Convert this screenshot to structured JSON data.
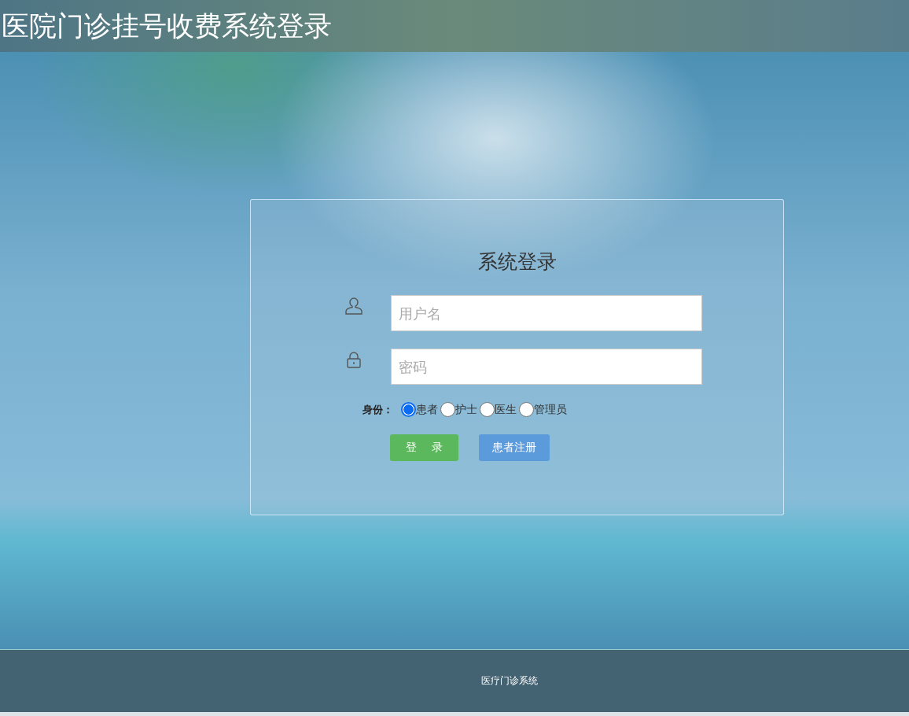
{
  "header": {
    "title": "医院门诊挂号收费系统登录"
  },
  "login": {
    "title": "系统登录",
    "username": {
      "placeholder": "用户名"
    },
    "password": {
      "placeholder": "密码"
    },
    "role_label": "身份：",
    "roles": [
      {
        "label": "患者",
        "selected": true
      },
      {
        "label": "护士",
        "selected": false
      },
      {
        "label": "医生",
        "selected": false
      },
      {
        "label": "管理员",
        "selected": false
      }
    ],
    "buttons": [
      {
        "label": "登　 录",
        "kind": "login"
      },
      {
        "label": "患者注册",
        "kind": "register"
      }
    ]
  },
  "footer": {
    "text": "医疗门诊系统"
  }
}
